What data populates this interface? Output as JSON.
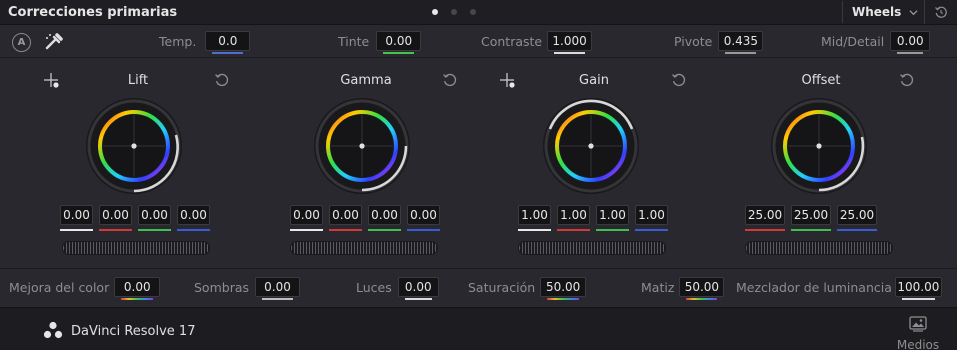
{
  "header": {
    "title": "Correcciones primarias",
    "page_dots": 3,
    "active_dot": 0,
    "mode": "Wheels"
  },
  "top_params": [
    {
      "label": "Temp.",
      "value": "0.0",
      "accent": "#4f6fd0"
    },
    {
      "label": "Tinte",
      "value": "0.00",
      "accent": "#43c44a"
    },
    {
      "label": "Contraste",
      "value": "1.000",
      "accent": "#dcdcdc"
    },
    {
      "label": "Pivote",
      "value": "0.435",
      "accent": "#9a9a9a"
    },
    {
      "label": "Mid/Detail",
      "value": "0.00",
      "accent": "#9a9a9a"
    }
  ],
  "wheels": [
    {
      "label": "Lift",
      "values": [
        "0.00",
        "0.00",
        "0.00",
        "0.00"
      ],
      "has_picker": true
    },
    {
      "label": "Gamma",
      "values": [
        "0.00",
        "0.00",
        "0.00",
        "0.00"
      ],
      "has_picker": false
    },
    {
      "label": "Gain",
      "values": [
        "1.00",
        "1.00",
        "1.00",
        "1.00"
      ],
      "has_picker": true
    },
    {
      "label": "Offset",
      "values": [
        "25.00",
        "25.00",
        "25.00"
      ],
      "has_picker": false
    }
  ],
  "channel_colors": [
    "#e8e8e8",
    "#d23a3a",
    "#3fbf50",
    "#3a5bd6"
  ],
  "offset_channel_colors": [
    "#d23a3a",
    "#3fbf50",
    "#3a5bd6"
  ],
  "bottom_params": [
    {
      "label": "Mejora del color",
      "value": "0.00"
    },
    {
      "label": "Sombras",
      "value": "0.00"
    },
    {
      "label": "Luces",
      "value": "0.00"
    },
    {
      "label": "Saturación",
      "value": "50.00"
    },
    {
      "label": "Matiz",
      "value": "50.00"
    },
    {
      "label": "Mezclador de luminancia",
      "value": "100.00"
    }
  ],
  "footer": {
    "app_name": "DaVinci Resolve 17",
    "media_label": "Medios"
  }
}
